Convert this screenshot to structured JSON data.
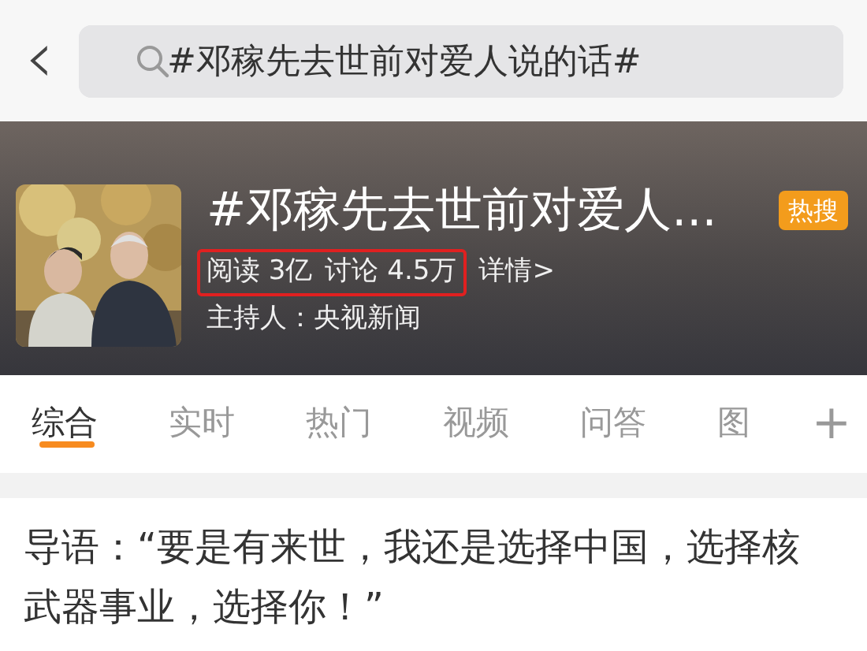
{
  "top_bar": {
    "back": "‹",
    "search": {
      "value": "#邓稼先去世前对爱人说的话#"
    }
  },
  "topic": {
    "title": "#邓稼先去世前对爱人...",
    "badge": "热搜",
    "stats": [
      {
        "text": "阅读 3亿"
      },
      {
        "text": "讨论 4.5万"
      }
    ],
    "stats_highlighted": true,
    "details_link": "详情>",
    "host": "主持人：央视新闻"
  },
  "tabs": [
    {
      "label": "综合",
      "selected": true
    },
    {
      "label": "实时",
      "selected": false
    },
    {
      "label": "热门",
      "selected": false
    },
    {
      "label": "视频",
      "selected": false
    },
    {
      "label": "问答",
      "selected": false
    },
    {
      "label": "图",
      "selected": false
    }
  ],
  "add_tab": "+",
  "intro": "导语：“要是有来世，我还是选择中国，选择核武器事业，选择你！”"
}
